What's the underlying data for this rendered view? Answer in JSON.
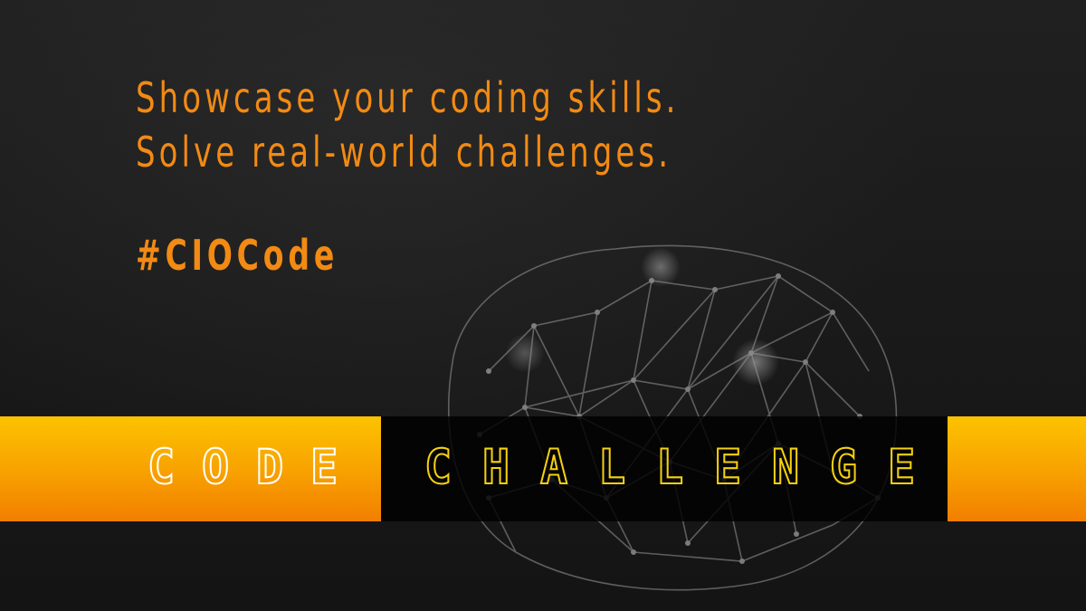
{
  "headline": {
    "line1": "Showcase your coding skills.",
    "line2": "Solve real-world challenges."
  },
  "hashtag": "#CIOCode",
  "title": {
    "word1": "CODE",
    "word2": "CHALLENGE"
  },
  "colors": {
    "accent": "#f28a13",
    "stripe_top": "#fcc300",
    "stripe_bottom": "#f27f00",
    "challenge_text": "#f5d10f",
    "background": "#151515"
  },
  "icons": {
    "background_graphic": "brain-network-icon"
  }
}
